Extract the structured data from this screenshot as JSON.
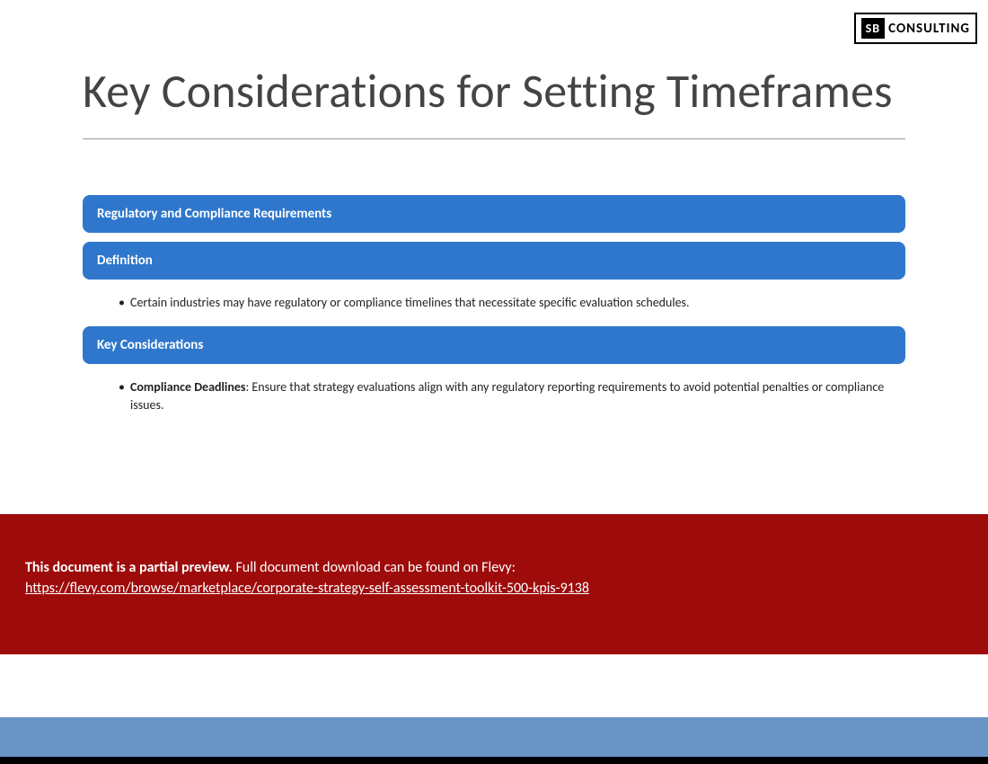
{
  "logo": {
    "badge": "SB",
    "text": "CONSULTING"
  },
  "title": "Key Considerations for Setting Timeframes",
  "sections": {
    "main_bar": "Regulatory and Compliance Requirements",
    "definition_label": "Definition",
    "definition_text": "Certain industries may have regulatory or compliance timelines that necessitate specific evaluation schedules.",
    "considerations_label": "Key Considerations",
    "consideration_item_bold": "Compliance Deadlines",
    "consideration_item_rest": ": Ensure that strategy evaluations align with any regulatory reporting requirements to avoid potential penalties or compliance issues."
  },
  "preview": {
    "bold_text": "This document is a partial preview.",
    "rest_text": "  Full document download can be found on Flevy:",
    "link_text": "https://flevy.com/browse/marketplace/corporate-strategy-self-assessment-toolkit-500-kpis-9138"
  }
}
